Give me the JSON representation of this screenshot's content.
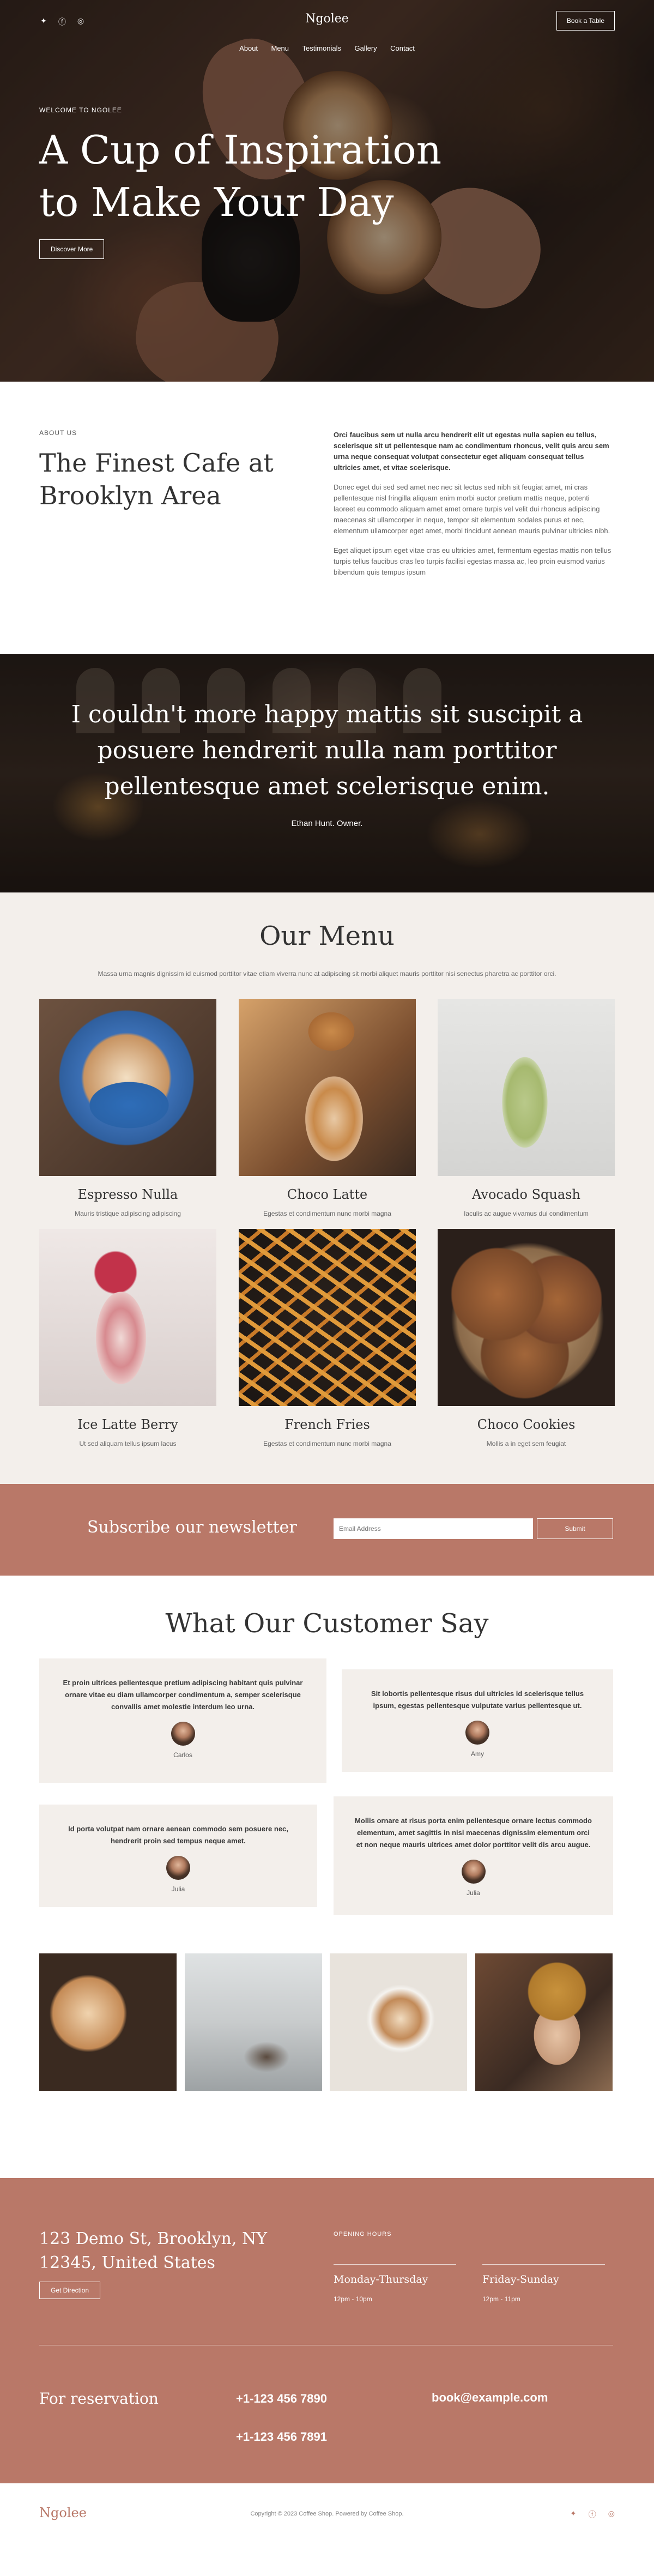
{
  "brand": {
    "logo": "Ngolee",
    "accent": "#b97868"
  },
  "header": {
    "socials": [
      {
        "icon": "twitter-icon",
        "glyph": "🐦"
      },
      {
        "icon": "facebook-icon",
        "glyph": "f"
      },
      {
        "icon": "instagram-icon",
        "glyph": "◎"
      }
    ],
    "social_glyphs": [
      "✦",
      "ⓕ",
      "◎"
    ],
    "book_label": "Book a Table",
    "nav": [
      "About",
      "Menu",
      "Testimonials",
      "Gallery",
      "Contact"
    ]
  },
  "hero": {
    "eyebrow": "WELCOME TO NGOLEE",
    "title": "A Cup of Inspiration to Make Your Day",
    "button": "Discover More"
  },
  "about": {
    "eyebrow": "ABOUT US",
    "title": "The Finest Cafe at Brooklyn Area",
    "p1": "Orci faucibus sem ut nulla arcu hendrerit elit ut egestas nulla sapien eu tellus, scelerisque sit ut pellentesque nam ac condimentum rhoncus, velit quis arcu sem urna neque consequat volutpat consectetur eget aliquam consequat tellus ultricies amet, et vitae scelerisque.",
    "p2": "Donec eget dui sed sed amet nec nec sit lectus sed nibh sit feugiat amet, mi cras pellentesque nisl fringilla aliquam enim morbi auctor pretium mattis neque, potenti laoreet eu commodo aliquam amet amet ornare turpis vel velit dui rhoncus adipiscing maecenas sit ullamcorper in neque, tempor sit elementum sodales purus et nec, elementum ullamcorper eget amet, morbi tincidunt aenean mauris pulvinar ultricies nibh.",
    "p3": "Eget aliquet ipsum eget vitae cras eu ultricies amet, fermentum egestas mattis non tellus turpis tellus faucibus cras leo turpis facilisi egestas massa ac, leo proin euismod varius bibendum quis tempus ipsum"
  },
  "quote": {
    "text": "I couldn't more happy mattis sit suscipit a posuere hendrerit nulla nam porttitor pellentesque amet scelerisque enim.",
    "author": "Ethan Hunt. Owner."
  },
  "menu": {
    "title": "Our Menu",
    "subtitle": "Massa urna magnis dignissim id euismod porttitor vitae etiam viverra nunc at adipiscing sit morbi aliquet mauris porttitor nisi senectus pharetra ac porttitor orci.",
    "items": [
      {
        "name": "Espresso Nulla",
        "desc": "Mauris tristique adipiscing adipiscing"
      },
      {
        "name": "Choco Latte",
        "desc": "Egestas et condimentum nunc morbi magna"
      },
      {
        "name": "Avocado Squash",
        "desc": "Iaculis ac augue vivamus dui condimentum"
      },
      {
        "name": "Ice Latte Berry",
        "desc": "Ut sed aliquam tellus ipsum lacus"
      },
      {
        "name": "French Fries",
        "desc": "Egestas et condimentum nunc morbi magna"
      },
      {
        "name": "Choco Cookies",
        "desc": "Mollis a in eget sem feugiat"
      }
    ]
  },
  "newsletter": {
    "title": "Subscribe our newsletter",
    "placeholder": "Email Address",
    "button": "Submit"
  },
  "testimonials": {
    "title": "What Our Customer Say",
    "items": [
      {
        "text": "Et proin ultrices pellentesque pretium adipiscing habitant quis pulvinar ornare vitae eu diam ullamcorper condimentum a, semper scelerisque convallis amet molestie interdum leo urna.",
        "name": "Carlos"
      },
      {
        "text": "Sit lobortis pellentesque risus dui ultricies id scelerisque tellus ipsum, egestas pellentesque vulputate varius pellentesque ut.",
        "name": "Amy"
      },
      {
        "text": "Id porta volutpat nam ornare aenean commodo sem posuere nec, hendrerit proin sed tempus neque amet.",
        "name": "Julia"
      },
      {
        "text": "Mollis ornare at risus porta enim pellentesque ornare lectus commodo elementum, amet sagittis in nisi maecenas dignissim elementum orci et non neque mauris ultrices amet dolor porttitor velit dis arcu augue.",
        "name": "Julia"
      }
    ]
  },
  "contact": {
    "address": "123 Demo St, Brooklyn, NY 12345, United States",
    "directions": "Get Direction",
    "hours_label": "OPENING HOURS",
    "hours": [
      {
        "day": "Monday-Thursday",
        "time": "12pm - 10pm"
      },
      {
        "day": "Friday-Sunday",
        "time": "12pm - 11pm"
      }
    ],
    "reservation": "For reservation",
    "phones": [
      "+1-123 456 7890",
      "+1-123 456 7891"
    ],
    "email": "book@example.com"
  },
  "footer": {
    "logo": "Ngolee",
    "copyright": "Copyright © 2023 Coffee Shop. Powered by Coffee Shop."
  }
}
